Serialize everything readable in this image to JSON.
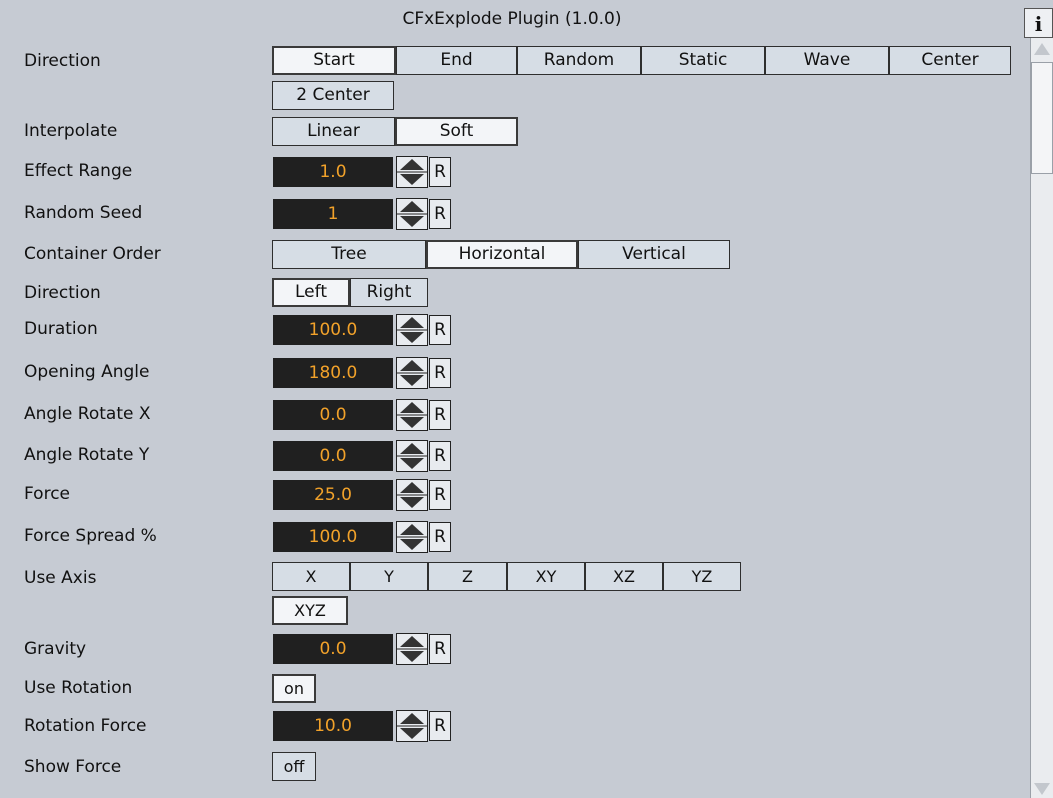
{
  "window": {
    "title": "CFxExplode Plugin (1.0.0)",
    "info_label": "i"
  },
  "direction": {
    "label": "Direction",
    "options": [
      "Start",
      "End",
      "Random",
      "Static",
      "Wave",
      "Center",
      "2 Center"
    ],
    "selected": "Start"
  },
  "interpolate": {
    "label": "Interpolate",
    "options": [
      "Linear",
      "Soft"
    ],
    "selected": "Soft"
  },
  "effect_range": {
    "label": "Effect Range",
    "value": "1.0",
    "reset": "R"
  },
  "random_seed": {
    "label": "Random Seed",
    "value": "1",
    "reset": "R"
  },
  "container_order": {
    "label": "Container Order",
    "options": [
      "Tree",
      "Horizontal",
      "Vertical"
    ],
    "selected": "Horizontal"
  },
  "direction2": {
    "label": "Direction",
    "options": [
      "Left",
      "Right"
    ],
    "selected": "Left"
  },
  "duration": {
    "label": "Duration",
    "value": "100.0",
    "reset": "R"
  },
  "opening_angle": {
    "label": "Opening Angle",
    "value": "180.0",
    "reset": "R"
  },
  "angle_rotate_x": {
    "label": "Angle Rotate X",
    "value": "0.0",
    "reset": "R"
  },
  "angle_rotate_y": {
    "label": "Angle Rotate Y",
    "value": "0.0",
    "reset": "R"
  },
  "force": {
    "label": "Force",
    "value": "25.0",
    "reset": "R"
  },
  "force_spread": {
    "label": "Force Spread %",
    "value": "100.0",
    "reset": "R"
  },
  "use_axis": {
    "label": "Use Axis",
    "options": [
      "X",
      "Y",
      "Z",
      "XY",
      "XZ",
      "YZ",
      "XYZ"
    ],
    "selected": "XYZ"
  },
  "gravity": {
    "label": "Gravity",
    "value": "0.0",
    "reset": "R"
  },
  "use_rotation": {
    "label": "Use Rotation",
    "toggle": "on"
  },
  "rotation_force": {
    "label": "Rotation Force",
    "value": "10.0",
    "reset": "R"
  },
  "show_force": {
    "label": "Show Force",
    "toggle": "off"
  },
  "colors": {
    "background": "#c6cbd3",
    "button": "#d6dde5",
    "selected_button": "#f3f5f8",
    "field_bg": "#202020",
    "field_text": "#f2a22a"
  }
}
